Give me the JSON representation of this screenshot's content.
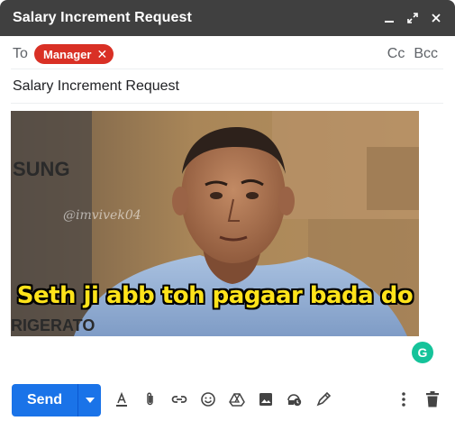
{
  "window": {
    "title": "Salary Increment Request",
    "controls": [
      "minimize-icon",
      "expand-icon",
      "close-icon"
    ]
  },
  "recipients": {
    "to_label": "To",
    "chips": [
      {
        "label": "Manager",
        "color": "#d93025"
      }
    ],
    "cc_label": "Cc",
    "bcc_label": "Bcc"
  },
  "subject": "Salary Increment Request",
  "body": {
    "image": {
      "caption": "Seth ji abb toh pagaar bada do",
      "watermark": "@imvivek04",
      "background_text_top": "SUNG",
      "background_text_bottom": "RIGERATO"
    }
  },
  "extension": {
    "grammarly_badge": "G"
  },
  "toolbar": {
    "send_label": "Send",
    "send_color": "#1a73e8",
    "formatting_icons": [
      "format-text-icon",
      "attach-icon",
      "link-icon",
      "emoji-icon",
      "drive-icon",
      "photo-icon",
      "confidential-icon",
      "signature-icon"
    ],
    "more_icon": "more-vert-icon",
    "discard_icon": "trash-icon"
  }
}
